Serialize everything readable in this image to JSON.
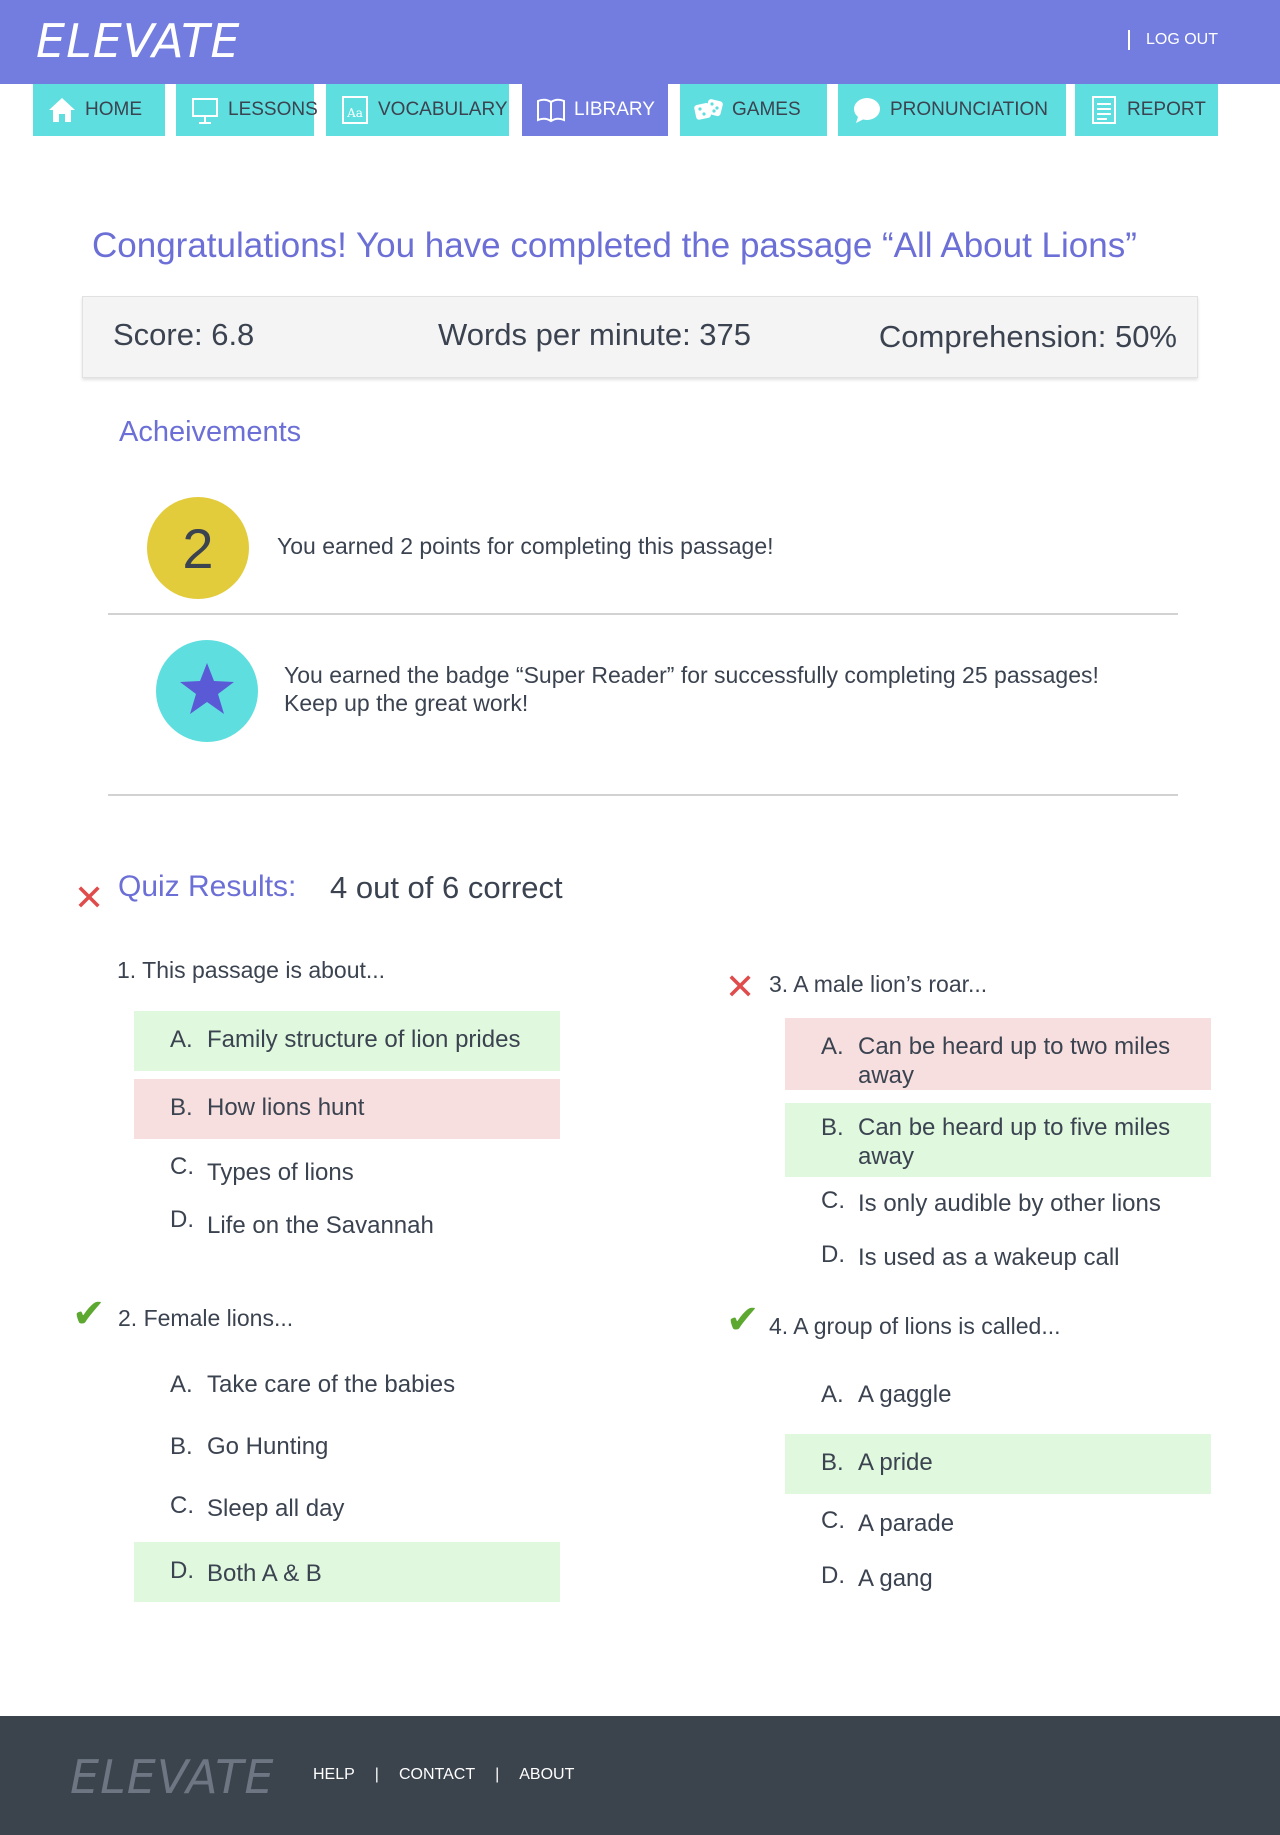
{
  "header": {
    "logo": "ELEVATE",
    "logout": "LOG OUT"
  },
  "nav": {
    "tabs": [
      {
        "label": "HOME",
        "icon": "home-icon"
      },
      {
        "label": "LESSONS",
        "icon": "easel-icon"
      },
      {
        "label": "VOCABULARY",
        "icon": "dictionary-icon"
      },
      {
        "label": "LIBRARY",
        "icon": "book-icon",
        "active": true
      },
      {
        "label": "GAMES",
        "icon": "dice-icon"
      },
      {
        "label": "PRONUNCIATION",
        "icon": "speech-bubble-icon"
      },
      {
        "label": "REPORT",
        "icon": "document-icon"
      }
    ]
  },
  "title": "Congratulations! You have completed the passage “All About Lions”",
  "scores": {
    "score": "Score: 6.8",
    "wpm": "Words per minute: 375",
    "comprehension": "Comprehension: 50%"
  },
  "achievements": {
    "heading": "Acheivements",
    "points_value": "2",
    "points_text": "You earned 2 points for completing this passage!",
    "badge_line1": "You earned the badge “Super Reader” for successfully completing 25 passages!",
    "badge_line2": "Keep up the great work!"
  },
  "quiz": {
    "heading": "Quiz Results:",
    "score": "4 out of 6 correct",
    "questions": [
      {
        "text": "1. This passage is about...",
        "options": [
          {
            "letter": "A.",
            "text": "Family structure of lion prides",
            "state": "correct"
          },
          {
            "letter": "B.",
            "text": "How lions hunt",
            "state": "wrong"
          },
          {
            "letter": "C.",
            "text": "Types of lions",
            "state": "none"
          },
          {
            "letter": "D.",
            "text": "Life on the Savannah",
            "state": "none"
          }
        ]
      },
      {
        "text": "2. Female lions...",
        "options": [
          {
            "letter": "A.",
            "text": "Take care of the babies",
            "state": "none"
          },
          {
            "letter": "B.",
            "text": "Go Hunting",
            "state": "none"
          },
          {
            "letter": "C.",
            "text": "Sleep all day",
            "state": "none"
          },
          {
            "letter": "D.",
            "text": "Both A & B",
            "state": "correct"
          }
        ]
      },
      {
        "text": "3. A male lion’s roar...",
        "options": [
          {
            "letter": "A.",
            "text": "Can be heard up to two miles away",
            "state": "wrong"
          },
          {
            "letter": "B.",
            "text": "Can be heard up to five miles away",
            "state": "correct"
          },
          {
            "letter": "C.",
            "text": "Is only audible by other lions",
            "state": "none"
          },
          {
            "letter": "D.",
            "text": "Is used as a wakeup call",
            "state": "none"
          }
        ]
      },
      {
        "text": "4. A group of lions is called...",
        "options": [
          {
            "letter": "A.",
            "text": "A gaggle",
            "state": "none"
          },
          {
            "letter": "B.",
            "text": "A pride",
            "state": "correct"
          },
          {
            "letter": "C.",
            "text": "A parade",
            "state": "none"
          },
          {
            "letter": "D.",
            "text": "A gang",
            "state": "none"
          }
        ]
      }
    ]
  },
  "footer": {
    "logo": "ELEVATE",
    "links": [
      "HELP",
      "CONTACT",
      "ABOUT"
    ]
  },
  "colors": {
    "header": "#727ddf",
    "tab": "#5fdedf",
    "accent_text": "#6b6fd6",
    "correct_bg": "#e0f8de",
    "wrong_bg": "#f7dfdf",
    "points_circle": "#e2cc3c",
    "footer": "#3b434d"
  }
}
